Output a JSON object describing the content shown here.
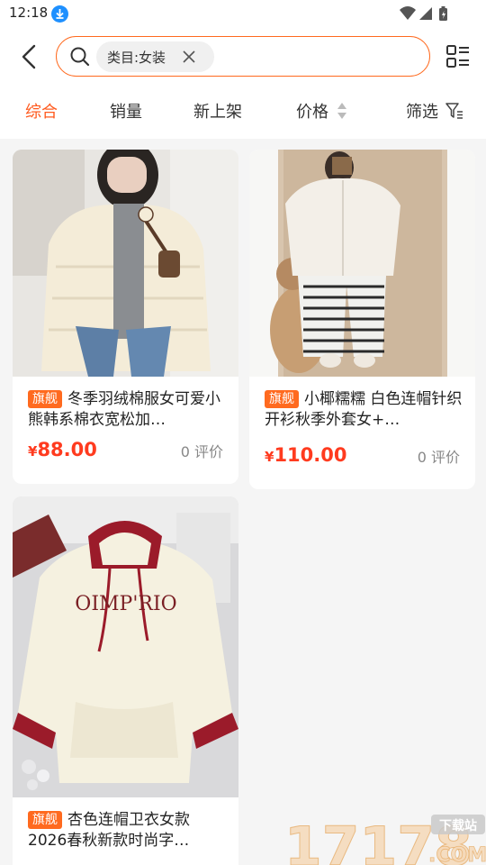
{
  "status_bar": {
    "time": "12:18"
  },
  "search": {
    "tag": "类目:女装"
  },
  "sort_tabs": [
    "综合",
    "销量",
    "新上架",
    "价格",
    "筛选"
  ],
  "products": [
    {
      "badge": "旗舰",
      "title": "冬季羽绒棉服女可爱小熊韩系棉衣宽松加…",
      "currency": "¥",
      "price": "88.00",
      "reviews": "0 评价"
    },
    {
      "badge": "旗舰",
      "title": "小椰糯糯 白色连帽针织开衫秋季外套女+…",
      "currency": "¥",
      "price": "110.00",
      "reviews": "0 评价"
    },
    {
      "badge": "旗舰",
      "title": "杏色连帽卫衣女款2026春秋新款时尚字…"
    }
  ],
  "watermark": {
    "number": "17178",
    "label": "下载站",
    "suffix": ".COM"
  },
  "colors": {
    "accent": "#ff5a1f",
    "price": "#ff3b1f",
    "badge": "#ff6a1f"
  },
  "icons": [
    "download-icon",
    "wifi-icon",
    "signal-icon",
    "battery-icon",
    "back-arrow-icon",
    "search-icon",
    "close-icon",
    "layout-toggle-icon",
    "sort-arrows-icon",
    "filter-icon"
  ]
}
